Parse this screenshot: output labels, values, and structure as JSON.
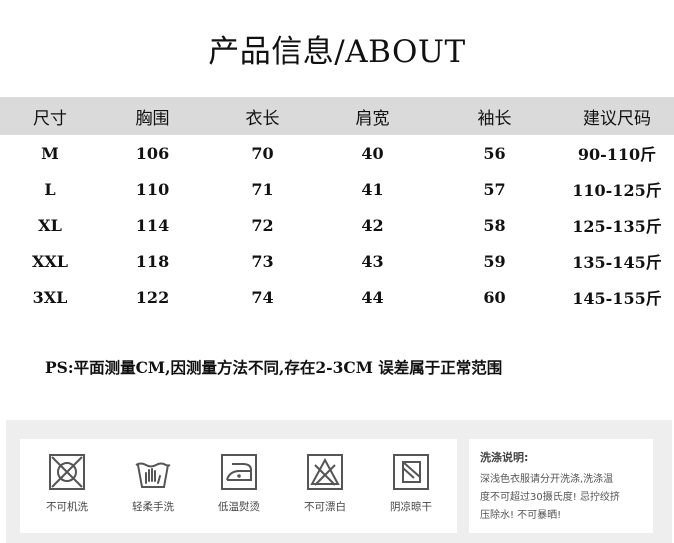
{
  "title": "产品信息/ABOUT",
  "table": {
    "headers": [
      "尺寸",
      "胸围",
      "衣长",
      "肩宽",
      "袖长",
      "建议尺码"
    ],
    "rows": [
      [
        "M",
        "106",
        "70",
        "40",
        "56",
        "90-110斤"
      ],
      [
        "L",
        "110",
        "71",
        "41",
        "57",
        "110-125斤"
      ],
      [
        "XL",
        "114",
        "72",
        "42",
        "58",
        "125-135斤"
      ],
      [
        "XXL",
        "118",
        "73",
        "43",
        "59",
        "135-145斤"
      ],
      [
        "3XL",
        "122",
        "74",
        "44",
        "60",
        "145-155斤"
      ]
    ]
  },
  "note": "PS:平面测量CM,因测量方法不同,存在2-3CM 误差属于正常范围",
  "care": {
    "items": [
      {
        "icon": "no-machine-wash-icon",
        "label": "不可机洗"
      },
      {
        "icon": "gentle-hand-wash-icon",
        "label": "轻柔手洗"
      },
      {
        "icon": "low-temp-iron-icon",
        "label": "低温熨烫"
      },
      {
        "icon": "no-bleach-icon",
        "label": "不可漂白"
      },
      {
        "icon": "shade-dry-icon",
        "label": "阴凉晾干"
      }
    ],
    "instructions_title": "洗涤说明:",
    "instructions_lines": [
      "深浅色衣服请分开洗涤,洗涤温",
      "度不可超过30摄氏度! 忌拧绞挤",
      "压除水! 不可暴晒!"
    ]
  },
  "colors": {
    "header_bg": "#dadada",
    "panel_bg": "#eeeeee",
    "icon_stroke": "#555555"
  }
}
